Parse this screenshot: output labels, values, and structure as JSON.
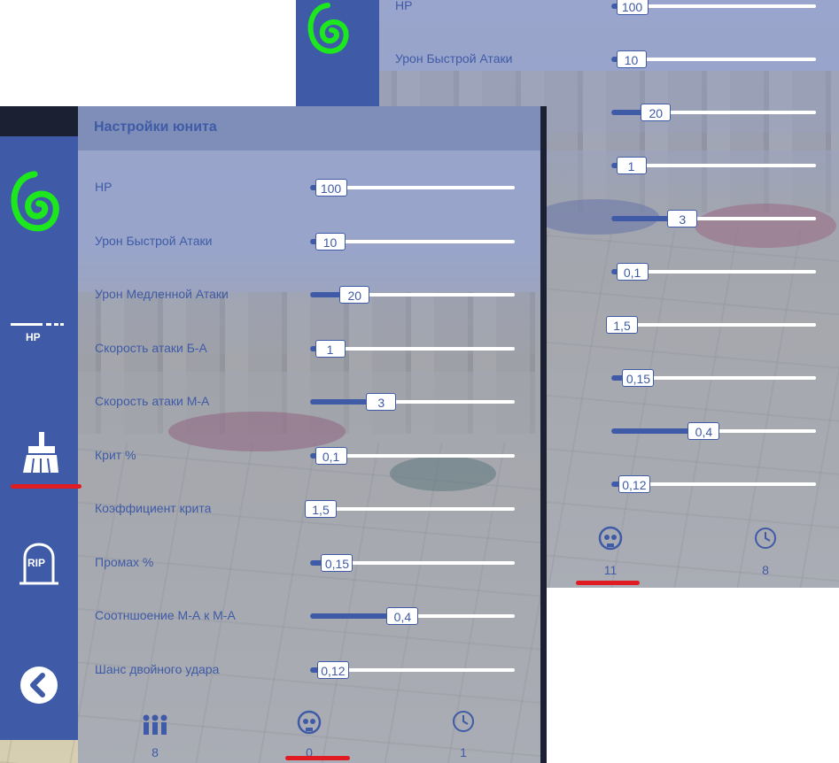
{
  "colors": {
    "accent": "#3f5ba7",
    "red": "#e01b22",
    "logo_green": "#1de71d"
  },
  "front": {
    "title": "Настройки юнита",
    "rows": [
      {
        "label": "HP",
        "value": "100",
        "fill": 0.05
      },
      {
        "label": "Урон Быстрой Атаки",
        "value": "10",
        "fill": 0.05
      },
      {
        "label": "Урон Медленной Атаки",
        "value": "20",
        "fill": 0.17
      },
      {
        "label": "Скорость атаки Б-А",
        "value": "1",
        "fill": 0.05
      },
      {
        "label": "Скорость атаки  М-А",
        "value": "3",
        "fill": 0.3
      },
      {
        "label": "Крит %",
        "value": "0,1",
        "fill": 0.05
      },
      {
        "label": "Коэффициент крита",
        "value": "1,5",
        "fill": 0.0
      },
      {
        "label": "Промах %",
        "value": "0,15",
        "fill": 0.08
      },
      {
        "label": "Соотншоение   М-А  к   М-А",
        "value": "0,4",
        "fill": 0.4
      },
      {
        "label": "Шанс  двойного удара",
        "value": "0,12",
        "fill": 0.06
      }
    ],
    "sidebar": {
      "logo_icon": "spiral-logo-icon",
      "items": [
        {
          "icon": "hp-bar-icon",
          "text": "HP"
        },
        {
          "icon": "broom-icon",
          "text": ""
        },
        {
          "icon": "tombstone-icon",
          "text": "RIP"
        },
        {
          "icon": "back-arrow-icon",
          "text": ""
        }
      ]
    },
    "footer": [
      {
        "icon": "people-icon",
        "count": "8"
      },
      {
        "icon": "skull-icon",
        "count": "0"
      },
      {
        "icon": "clock-icon",
        "count": "1"
      }
    ]
  },
  "back": {
    "rows": [
      {
        "label": "HP",
        "value": "100",
        "fill": 0.05
      },
      {
        "label": "Урон Быстрой Атаки",
        "value": "10",
        "fill": 0.05
      },
      {
        "label": "аки",
        "value": "20",
        "fill": 0.17
      },
      {
        "label": "",
        "value": "1",
        "fill": 0.05
      },
      {
        "label": "",
        "value": "3",
        "fill": 0.3
      },
      {
        "label": "",
        "value": "0,1",
        "fill": 0.05
      },
      {
        "label": "",
        "value": "1,5",
        "fill": 0.0
      },
      {
        "label": "",
        "value": "0,15",
        "fill": 0.08
      },
      {
        "label": "к   М-А",
        "value": "0,4",
        "fill": 0.4
      },
      {
        "label": "а",
        "value": "0,12",
        "fill": 0.06
      }
    ],
    "footer": [
      {
        "icon": "skull-icon",
        "count": "11"
      },
      {
        "icon": "clock-icon",
        "count": "8"
      }
    ]
  }
}
